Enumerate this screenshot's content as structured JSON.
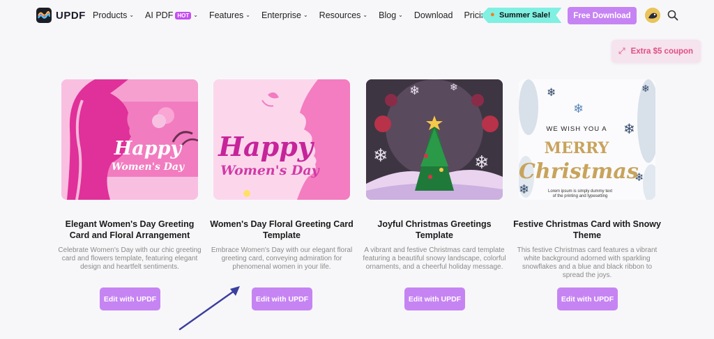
{
  "brand": {
    "name": "UPDF"
  },
  "nav": {
    "items": [
      {
        "label": "Products",
        "dropdown": true
      },
      {
        "label": "AI PDF",
        "badge": "HOT",
        "dropdown": true
      },
      {
        "label": "Features",
        "dropdown": true
      },
      {
        "label": "Enterprise",
        "dropdown": true
      },
      {
        "label": "Resources",
        "dropdown": true
      },
      {
        "label": "Blog",
        "dropdown": true
      },
      {
        "label": "Download",
        "dropdown": false
      },
      {
        "label": "Pricing",
        "dropdown": false
      }
    ],
    "summer_sale": "Summer Sale!",
    "free_download": "Free Download"
  },
  "coupon": {
    "label": "Extra $5 coupon"
  },
  "cards": [
    {
      "title": "Elegant Women's Day Greeting Card and Floral Arrangement",
      "description": "Celebrate Women's Day with our chic greeting card and flowers template, featuring elegant design and heartfelt sentiments.",
      "button": "Edit with UPDF",
      "thumb_line1": "Happy",
      "thumb_line2": "Women's Day"
    },
    {
      "title": "Women's Day Floral Greeting Card Template",
      "description": "Embrace Women's Day with our elegant floral greeting card, conveying admiration for phenomenal women in your life.",
      "button": "Edit with UPDF",
      "thumb_line1": "Happy",
      "thumb_line2": "Women's Day"
    },
    {
      "title": "Joyful Christmas Greetings Template",
      "description": "A vibrant and festive Christmas card template featuring a beautiful snowy landscape, colorful ornaments, and a cheerful holiday message.",
      "button": "Edit with UPDF"
    },
    {
      "title": "Festive Christmas Card with Snowy Theme",
      "description": "This festive Christmas card features a vibrant white background adorned with sparkling snowflakes and a blue and black ribbon to spread the joys.",
      "button": "Edit with UPDF",
      "thumb_line0": "WE WISH YOU A",
      "thumb_line1": "MERRY",
      "thumb_line2": "Christmas",
      "thumb_small": "Lorem ipsum is simply dummy text of the printing and typesetting"
    }
  ],
  "colors": {
    "accent": "#c684f3",
    "summer": "#7ff0e2",
    "coupon_text": "#e04f84"
  },
  "icons": [
    "updf-logo-icon",
    "chevron-down-icon",
    "flame-icon",
    "search-icon",
    "expand-icon"
  ]
}
